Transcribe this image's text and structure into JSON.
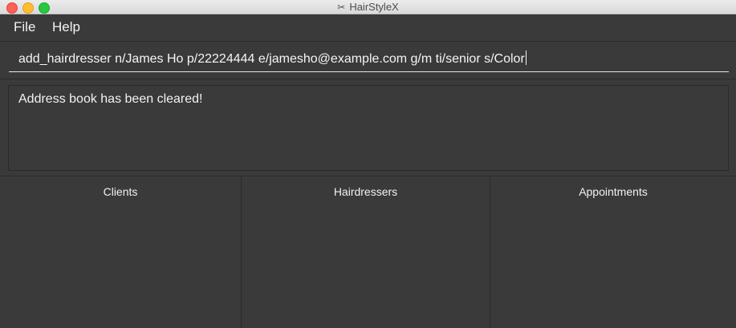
{
  "window": {
    "title": "HairStyleX",
    "title_icon": "scissors-icon"
  },
  "menu": {
    "file": "File",
    "help": "Help"
  },
  "command": {
    "value": "add_hairdresser n/James Ho p/22224444 e/jamesho@example.com  g/m ti/senior s/Color"
  },
  "result": {
    "text": "Address book has been cleared!"
  },
  "panels": {
    "clients": "Clients",
    "hairdressers": "Hairdressers",
    "appointments": "Appointments"
  },
  "colors": {
    "background": "#3a3a3a",
    "text": "#f2f2f2",
    "close": "#fe5f57",
    "minimize": "#febc2e",
    "maximize": "#28c840"
  }
}
